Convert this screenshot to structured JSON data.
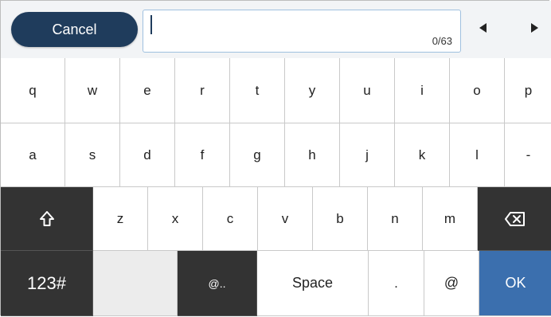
{
  "header": {
    "cancel_label": "Cancel",
    "text_value": "",
    "char_counter": "0/63",
    "cursor_left_icon": "triangle-left",
    "cursor_right_icon": "triangle-right"
  },
  "keyboard": {
    "row1": [
      "q",
      "w",
      "e",
      "r",
      "t",
      "y",
      "u",
      "i",
      "o",
      "p"
    ],
    "row2": [
      "a",
      "s",
      "d",
      "f",
      "g",
      "h",
      "j",
      "k",
      "l",
      "-"
    ],
    "row3": {
      "shift_icon": "shift-arrow-up",
      "keys": [
        "z",
        "x",
        "c",
        "v",
        "b",
        "n",
        "m"
      ],
      "backspace_icon": "backspace-x"
    },
    "row4": {
      "mode_label": "123#",
      "blank_label": "",
      "domain_label": "@..",
      "space_label": "Space",
      "dot_label": ".",
      "at_label": "@",
      "ok_label": "OK"
    }
  },
  "colors": {
    "cancel_bg": "#1f3c5c",
    "ok_bg": "#3b6fae",
    "dark_key_bg": "#333333",
    "field_border": "#9fc0df"
  }
}
